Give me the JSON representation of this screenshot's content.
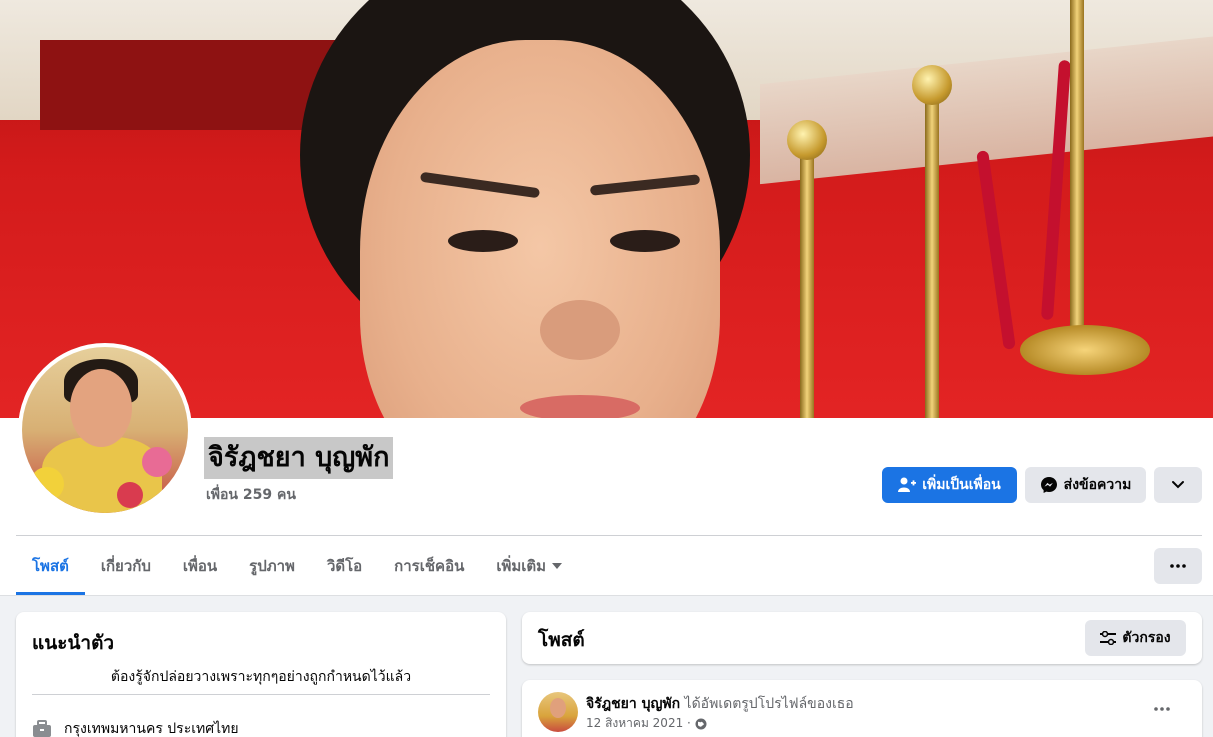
{
  "profile": {
    "name": "จิรัฎชยา บุญพัก",
    "friends_count": "เพื่อน 259 คน"
  },
  "actions": {
    "add_friend": "เพิ่มเป็นเพื่อน",
    "message": "ส่งข้อความ"
  },
  "tabs": [
    {
      "label": "โพสต์",
      "active": true
    },
    {
      "label": "เกี่ยวกับ"
    },
    {
      "label": "เพื่อน"
    },
    {
      "label": "รูปภาพ"
    },
    {
      "label": "วิดีโอ"
    },
    {
      "label": "การเช็คอิน"
    },
    {
      "label": "เพิ่มเติม"
    }
  ],
  "intro": {
    "title": "แนะนำตัว",
    "bio": "ต้องรู้จักปล่อยวางเพราะทุกๆอย่างถูกกำหนดไว้แล้ว",
    "location": "กรุงเทพมหานคร ประเทศไทย"
  },
  "posts": {
    "title": "โพสต์",
    "filter_label": "ตัวกรอง",
    "items": [
      {
        "author": "จิรัฎชยา บุญพัก",
        "action": "ได้อัพเดตรูปโปรไฟล์ของเธอ",
        "date": "12 สิงหาคม 2021 ·"
      }
    ]
  },
  "colors": {
    "accent": "#1b74e4",
    "background": "#f0f2f5",
    "button_grey": "#e4e6eb"
  }
}
